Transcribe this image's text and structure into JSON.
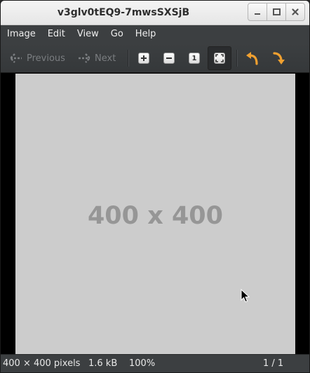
{
  "window": {
    "title": "v3glv0tEQ9-7mwsSXSjB"
  },
  "menu": {
    "items": [
      "Image",
      "Edit",
      "View",
      "Go",
      "Help"
    ]
  },
  "toolbar": {
    "previous_label": "Previous",
    "next_label": "Next",
    "buttons": [
      {
        "icon": "zoom-in-icon"
      },
      {
        "icon": "zoom-out-icon"
      },
      {
        "icon": "zoom-normal-icon",
        "glyph": "1"
      },
      {
        "icon": "zoom-fit-icon",
        "active": true
      },
      {
        "icon": "rotate-left-icon",
        "color": "#f0a030"
      },
      {
        "icon": "rotate-right-icon",
        "color": "#f0a030"
      }
    ]
  },
  "image": {
    "label": "400 x 400",
    "background": "#cccccc",
    "text_color": "#969696"
  },
  "status": {
    "dimensions": "400 × 400 pixels",
    "file_size": "1.6 kB",
    "zoom": "100%",
    "page": "1 / 1"
  }
}
